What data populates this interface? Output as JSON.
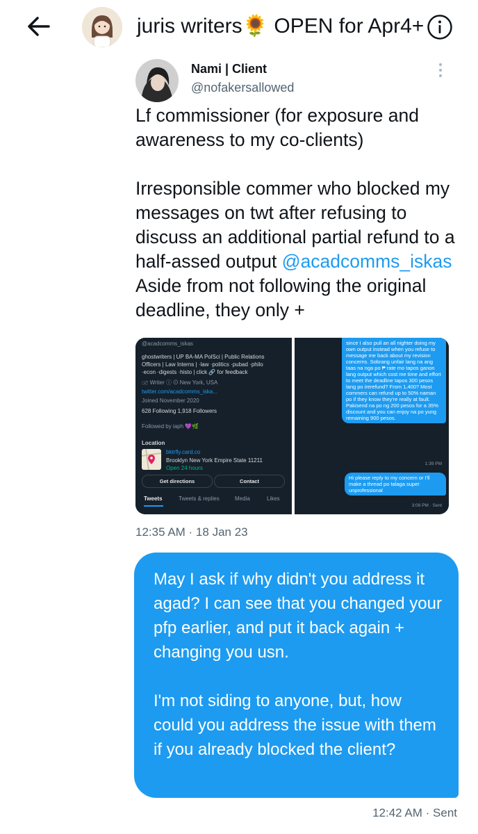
{
  "header": {
    "title": "juris writers🌻 OPEN for Apr4+",
    "back_icon": "back-arrow-icon",
    "info_icon": "info-icon"
  },
  "quoted_tweet": {
    "name": "Nami | Client",
    "handle": "@nofakersallowed",
    "text_p1": "Lf commissioner (for exposure and awareness to my co-clients)",
    "text_p2_before": "Irresponsible commer who blocked my messages on twt after refusing to discuss an additional partial refund to a half-assed output ",
    "mention": "@acadcomms_iskas",
    "text_p2_after": " Aside from not following the original deadline, they only +",
    "timestamp": "12:35 AM · 18 Jan 23",
    "media": {
      "left": {
        "handle": "@acadcomms_iskas",
        "bio1": "ghostwriters | UP BA-MA PolSci | Public Relations",
        "bio2": "Officers | Law Interns | ·law ·politics ·pubad ·philo",
        "bio3": "·econ ·digests ·histo | click 🔗 for feedback",
        "meta": "🖃 Writer ⓘ   ⊙ New York, USA",
        "link": "twitter.com/acadcomms_iska...",
        "joined": "Joined November 2020",
        "stats": "628 Following  1,918 Followers",
        "followed": "Followed by iaph 💜🌿",
        "location_label": "Location",
        "location_link": "bktrfly.card.co",
        "location_addr": "Brooklyn New York Empire State 11211",
        "location_hours": "Open 24 hours",
        "btn_directions": "Get directions",
        "btn_contact": "Contact",
        "tabs": [
          "Tweets",
          "Tweets & replies",
          "Media",
          "Likes"
        ]
      },
      "right": {
        "bubble1": "since I also pull an all nighter doing my own output instead when you refuse to message me back about my revision concerns. Sobrang unfair lang na ang taas na nga po ₱ rate mo tapos ganon lang output which cost me time and effort to meet the deadline tapos 300 pesos lang po irerefund? From 1,400? Most commers can refund up to 50% naman po if they know they're really at fault. Pakisend na po ng 200 pesos for a 35% discount and you can enjoy na po yung remaining 900 pesos.",
        "time1": "1:39 PM",
        "bubble2": "Hi please reply to my concern or I'll make a thread po talaga super unprofessional",
        "time2": "3:08 PM · Sent"
      }
    }
  },
  "message": {
    "p1": "May I ask if why didn't you address it agad? I can see that you changed your pfp earlier, and put it back again + changing you usn.",
    "p2": "I'm not siding to anyone, but, how could you address the issue with them if you already blocked the client?",
    "meta": "12:42 AM · Sent"
  },
  "colors": {
    "accent": "#1d9bf0",
    "muted": "#536471",
    "dark_bg": "#15202b"
  }
}
